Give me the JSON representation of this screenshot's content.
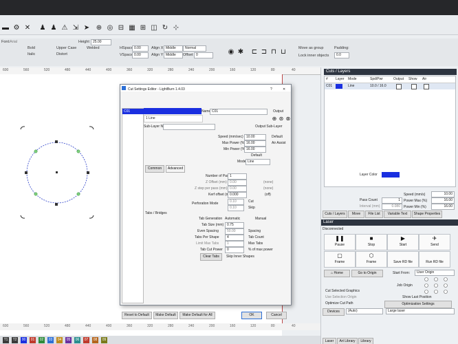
{
  "colors": {
    "accent": "#1a2fe0",
    "layer_color": "#1a2fe0",
    "selection": "#2f8f2f"
  },
  "options": {
    "font_label": "Font:",
    "font_value": "Arial",
    "height_label": "Height",
    "height_value": "25.00",
    "hspace_label": "HSpace",
    "hspace_value": "0.00",
    "vspace_label": "VSpace",
    "vspace_value": "0.00",
    "align_x_label": "Align X",
    "align_x_value": "Middle",
    "align_y_label": "Align Y",
    "align_y_value": "Middle",
    "normal_label": "Normal",
    "offset_label": "Offset",
    "offset_value": "0",
    "bold": "Bold",
    "upper_case": "Upper Case",
    "welded": "Welded",
    "italic": "Italic",
    "distort": "Distort",
    "move_as_group": "Move as group",
    "lock_inner_objects": "Lock inner objects",
    "padding_label": "Padding:",
    "padding_value": "0.0"
  },
  "ruler_top": [
    "600",
    "560",
    "520",
    "480",
    "440",
    "400",
    "360",
    "320",
    "280",
    "240",
    "200",
    "160",
    "120",
    "80",
    "40"
  ],
  "ruler_bottom": [
    "600",
    "560",
    "520",
    "480",
    "440",
    "400",
    "360",
    "320",
    "280",
    "240",
    "200",
    "160",
    "120",
    "80",
    "40"
  ],
  "palette": [
    "T1",
    "T2",
    "00",
    "01",
    "02",
    "03",
    "04",
    "05",
    "06",
    "07",
    "08",
    "09"
  ],
  "cuts_layers": {
    "title": "Cuts / Layers",
    "cols": [
      "#",
      "Layer",
      "Mode",
      "Spd/Pwr",
      "Output",
      "Show",
      "Air"
    ],
    "row": {
      "num": "C01",
      "mode": "Line",
      "spdpwr": "10.0 / 16.0"
    },
    "layer_color_label": "Layer Color",
    "speed_label": "Speed (mm/s)",
    "speed_value": "10.00",
    "pass_count_label": "Pass Count",
    "pass_count_value": "1",
    "power_max_label": "Power Max (%)",
    "power_max_value": "16.00",
    "interval_label": "Interval (mm)",
    "interval_value": "0.080",
    "power_min_label": "Power Min (%)",
    "power_min_value": "16.00",
    "tabs": [
      "Cuts / Layers",
      "Move",
      "File List",
      "Variable Text",
      "Shape Properties"
    ]
  },
  "laser": {
    "title": "Laser",
    "status": "Disconnected",
    "pause": "Pause",
    "stop": "Stop",
    "start": "Start",
    "send": "Send",
    "frame1": "Frame",
    "frame2": "Frame",
    "save_rd": "Save RD file",
    "run_rd": "Run RD file",
    "home": "Home",
    "go_to_origin": "Go to Origin",
    "start_from_label": "Start From:",
    "start_from_value": "User Origin",
    "job_origin_label": "Job Origin",
    "cut_selected": "Cut Selected Graphics",
    "use_selection_origin": "Use Selection Origin",
    "optimize_cut_path": "Optimize Cut Path",
    "show_last_position": "Show Last Position",
    "optimization_settings": "Optimization Settings",
    "devices": "Devices",
    "auto": "(Auto)",
    "large_laser": "Large laser",
    "bottom_tabs": [
      "Laser",
      "Art Library",
      "Library"
    ]
  },
  "dialog": {
    "title": "Cut Settings Editor - LightBurn 1.4.03",
    "help": "?",
    "close": "✕",
    "list_item": "C01",
    "sublayer_item": "1 Line",
    "name_label": "Name",
    "name_value": "C01",
    "output_label": "Output",
    "sublayer_name_label": "Sub-Layer Name",
    "output_sublayer_label": "Output Sub-Layer",
    "speed_label": "Speed (mm/sec)",
    "speed_value": "10.00",
    "default_label": "Default",
    "max_power_label": "Max Power (%)",
    "max_power_value": "16.00",
    "air_assist_label": "Air Assist",
    "min_power_label": "Min Power (%)",
    "min_power_value": "16.00",
    "default2_label": "Default",
    "mode_label": "Mode",
    "mode_value": "Line",
    "tab_common": "Common",
    "tab_advanced": "Advanced",
    "passes_label": "Number of Passes",
    "passes_value": "1",
    "z_offset_label": "Z Offset (mm)",
    "z_offset_value": "0.00",
    "z_offset_note": "(none)",
    "z_step_label": "Z step per pass (mm)",
    "z_step_value": "0.00",
    "z_step_note": "(none)",
    "kerf_label": "Kerf offset (mm)",
    "kerf_value": "0.000",
    "kerf_note": "(off)",
    "perforation_label": "Perforation Mode",
    "perf_cut_value": "0.10",
    "perf_cut_label": "Cut",
    "perf_skip_value": "0.10",
    "perf_skip_label": "Skip",
    "tabs_bridges_label": "Tabs / Bridges",
    "tab_gen_label": "Tab Generation",
    "automatic": "Automatic",
    "manual": "Manual",
    "tab_size_label": "Tab Size (mm)",
    "tab_size_value": "0.75",
    "even_spacing_label": "Even Spacing",
    "even_spacing_value": "50.00",
    "spacing_label": "Spacing",
    "tabs_per_shape_label": "Tabs Per Shape",
    "tabs_per_shape_value": "4",
    "tab_count_label": "Tab Count",
    "limit_max_tabs_label": "Limit Max Tabs",
    "limit_max_value": "1",
    "max_tabs_label": "Max Tabs",
    "tab_cut_power_label": "Tab Cut Power",
    "tab_cut_power_value": "0",
    "pct_max_power": "% of max power",
    "clear_tabs": "Clear Tabs",
    "skip_inner": "Skip Inner Shapes",
    "reset_default": "Reset to Default",
    "make_default": "Make Default",
    "make_default_all": "Make Default for All",
    "ok": "OK",
    "cancel": "Cancel"
  }
}
